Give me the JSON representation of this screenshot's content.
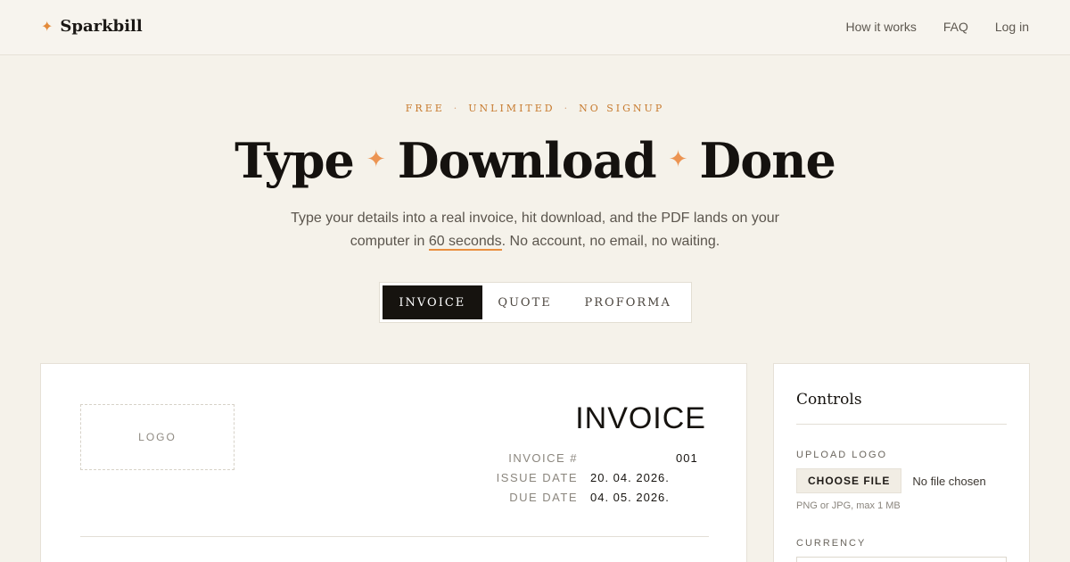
{
  "header": {
    "brand": "Sparkbill",
    "nav": [
      "How it works",
      "FAQ",
      "Log in"
    ]
  },
  "hero": {
    "eyebrow": [
      "FREE",
      "UNLIMITED",
      "NO SIGNUP"
    ],
    "headline": [
      "Type",
      "Download",
      "Done"
    ],
    "sub_before": "Type your details into a real invoice, hit download, and the PDF lands on your computer in ",
    "sub_highlight": "60 seconds",
    "sub_after": ". No account, no email, no waiting.",
    "tabs": [
      "INVOICE",
      "QUOTE",
      "PROFORMA"
    ],
    "active_tab": "INVOICE"
  },
  "invoice": {
    "logo_placeholder": "LOGO",
    "title": "INVOICE",
    "number_label": "INVOICE #",
    "number": "001",
    "issue_label": "ISSUE DATE",
    "issue_date": "20. 04. 2026.",
    "due_label": "DUE DATE",
    "due_date": "04. 05. 2026."
  },
  "controls": {
    "title": "Controls",
    "upload_label": "UPLOAD LOGO",
    "choose_file": "CHOOSE FILE",
    "file_status": "No file chosen",
    "hint": "PNG or JPG, max 1 MB",
    "currency_label": "CURRENCY"
  },
  "colors": {
    "accent": "#e38a3a",
    "background": "#f5f2ea",
    "ink": "#16130f"
  },
  "icons": {
    "brand": "sparkle-icon",
    "headline_separator": "sparkle-icon"
  }
}
